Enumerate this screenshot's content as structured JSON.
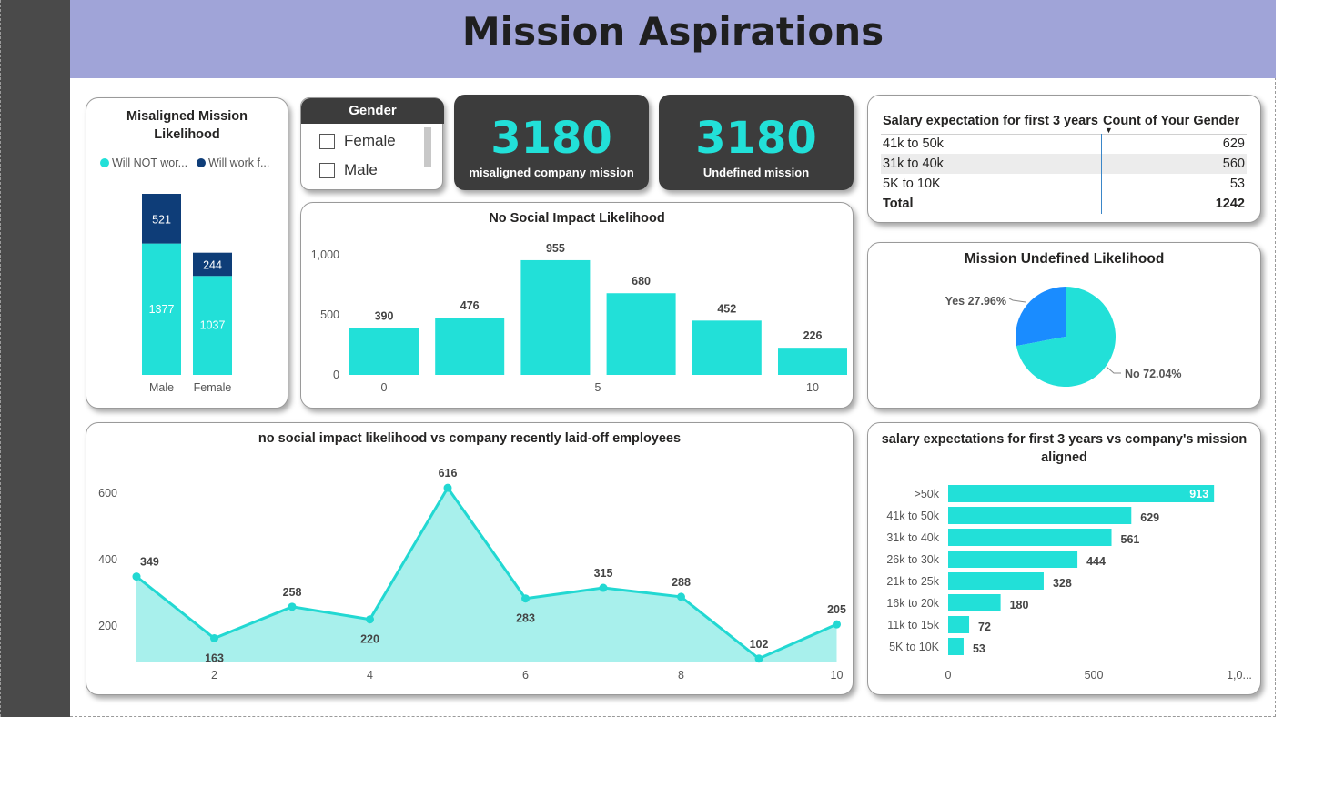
{
  "page_title": "Mission Aspirations",
  "misaligned_card": {
    "title_line1": "Misaligned Mission",
    "title_line2": "Likelihood",
    "legend": [
      {
        "label": "Will NOT wor...",
        "color": "#22e0d8"
      },
      {
        "label": "Will work f...",
        "color": "#0e3d78"
      }
    ],
    "chart_data": {
      "type": "bar",
      "stacked": true,
      "categories": [
        "Male",
        "Female"
      ],
      "series": [
        {
          "name": "Will NOT wor...",
          "values": [
            1377,
            1037
          ],
          "color": "#22e0d8"
        },
        {
          "name": "Will work f...",
          "values": [
            521,
            244
          ],
          "color": "#0e3d78"
        }
      ]
    }
  },
  "gender_slicer": {
    "title": "Gender",
    "options": [
      "Female",
      "Male"
    ]
  },
  "kpi_misaligned": {
    "value": "3180",
    "label": "misaligned company mission"
  },
  "kpi_undefined": {
    "value": "3180",
    "label": "Undefined mission"
  },
  "salary_matrix": {
    "col1_header": "Salary expectation for first 3 years",
    "col2_header": "Count of Your Gender",
    "rows": [
      {
        "label": "41k to 50k",
        "value": "629"
      },
      {
        "label": "31k to 40k",
        "value": "560"
      },
      {
        "label": "5K to 10K",
        "value": "53"
      }
    ],
    "total_label": "Total",
    "total_value": "1242"
  },
  "no_social_card": {
    "title": "No Social Impact Likelihood",
    "chart_data": {
      "type": "bar",
      "x": [
        0,
        2,
        4,
        6,
        8,
        10
      ],
      "values": [
        390,
        476,
        955,
        680,
        452,
        226
      ],
      "data_labels": [
        "390",
        "476",
        "955",
        "680",
        "452",
        "226"
      ],
      "y_ticks": [
        "0",
        "500",
        "1,000"
      ],
      "x_ticks": [
        "0",
        "5",
        "10"
      ],
      "ylim": [
        0,
        1000
      ],
      "color": "#22e0d8"
    }
  },
  "mission_undefined_card": {
    "title": "Mission Undefined Likelihood",
    "chart_data": {
      "type": "pie",
      "slices": [
        {
          "name": "Yes",
          "value": 27.96,
          "label": "Yes 27.96%",
          "color": "#1a8cff"
        },
        {
          "name": "No",
          "value": 72.04,
          "label": "No 72.04%",
          "color": "#22e0d8"
        }
      ]
    }
  },
  "line_card": {
    "title": "no social impact likelihood vs company recently laid-off employees",
    "chart_data": {
      "type": "area",
      "x": [
        1,
        2,
        3,
        4,
        5,
        6,
        7,
        8,
        9,
        10
      ],
      "values": [
        349,
        163,
        258,
        220,
        616,
        283,
        315,
        288,
        102,
        205
      ],
      "data_labels": [
        "349",
        "163",
        "258",
        "220",
        "616",
        "283",
        "315",
        "288",
        "102",
        "205"
      ],
      "y_ticks": [
        "200",
        "400",
        "600"
      ],
      "x_ticks": [
        "2",
        "4",
        "6",
        "8",
        "10"
      ],
      "color": "#22d8d2"
    }
  },
  "salary_bar_card": {
    "title_line1": "salary expectations for first 3 years vs company's mission",
    "title_line2": "aligned",
    "chart_data": {
      "type": "bar",
      "orientation": "horizontal",
      "categories": [
        ">50k",
        "41k to 50k",
        "31k to 40k",
        "26k to 30k",
        "21k to 25k",
        "16k to 20k",
        "11k to 15k",
        "5K to 10K"
      ],
      "values": [
        913,
        629,
        561,
        444,
        328,
        180,
        72,
        53
      ],
      "data_labels": [
        "913",
        "629",
        "561",
        "444",
        "328",
        "180",
        "72",
        "53"
      ],
      "x_ticks": [
        "0",
        "500",
        "1,0..."
      ],
      "xlim": [
        0,
        1000
      ],
      "color": "#22e0d8"
    }
  }
}
